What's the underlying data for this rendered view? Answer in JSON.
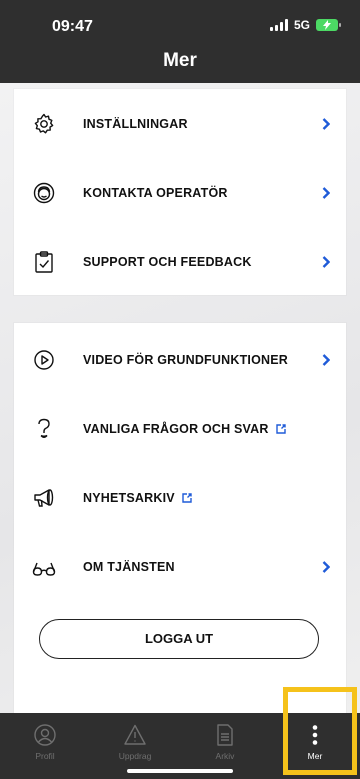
{
  "status": {
    "time": "09:47",
    "network": "5G"
  },
  "header": {
    "title": "Mer"
  },
  "menu": {
    "group1": [
      {
        "label": "INSTÄLLNINGAR",
        "icon": "settings-gear-icon"
      },
      {
        "label": "KONTAKTA OPERATÖR",
        "icon": "headset-operator-icon"
      },
      {
        "label": "SUPPORT OCH FEEDBACK",
        "icon": "clipboard-check-icon"
      }
    ],
    "group2": [
      {
        "label": "VIDEO FÖR GRUNDFUNKTIONER",
        "icon": "play-circle-icon"
      },
      {
        "label": "VANLIGA FRÅGOR OCH SVAR",
        "icon": "question-icon"
      },
      {
        "label": "NYHETSARKIV",
        "icon": "megaphone-icon"
      },
      {
        "label": "OM TJÄNSTEN",
        "icon": "glasses-icon"
      }
    ],
    "logout_label": "LOGGA UT"
  },
  "tabs": [
    {
      "label": "Profil",
      "icon": "profile-icon"
    },
    {
      "label": "Uppdrag",
      "icon": "warning-triangle-icon"
    },
    {
      "label": "Arkiv",
      "icon": "document-icon"
    },
    {
      "label": "Mer",
      "icon": "more-dots-icon",
      "active": true
    }
  ],
  "colors": {
    "accent": "#1f5bd8",
    "highlight": "#f5c21b",
    "dark": "#2f2f2f"
  }
}
